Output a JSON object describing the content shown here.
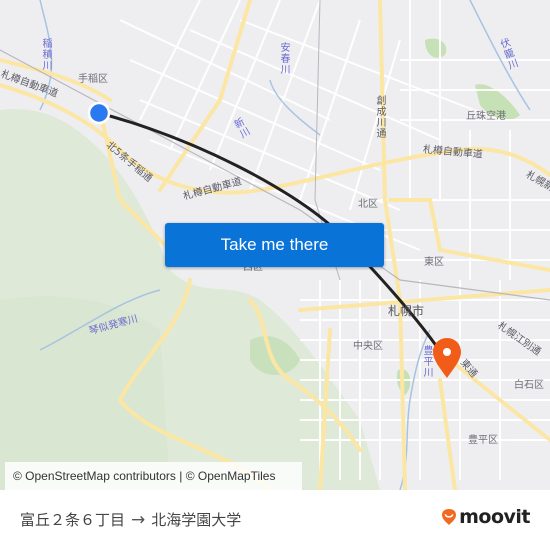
{
  "map": {
    "button_label": "Take me there",
    "attribution": "© OpenStreetMap contributors | © OpenMapTiles",
    "district_labels": [
      "手稲区",
      "北区",
      "東区",
      "中央区",
      "白石区",
      "豊平区",
      "丘珠空港",
      "札幌市",
      "西区"
    ],
    "river_labels": [
      "稲積川",
      "安春川",
      "新川",
      "創成川通",
      "伏籠川",
      "琴似発寒川",
      "豊平川"
    ],
    "road_labels": [
      "札樽自動車道",
      "札樽自動車道",
      "札樽自動車道",
      "北5条手稲通",
      "札幌江別通",
      "札幌新道",
      "東通"
    ],
    "origin_color": "#2a79f0",
    "destination_color": "#f25c19",
    "route_color": "#222222"
  },
  "footer": {
    "origin": "富丘２条６丁目",
    "arrow": "→",
    "destination": "北海学園大学",
    "brand": "moovit",
    "brand_color": "#f26a21"
  }
}
